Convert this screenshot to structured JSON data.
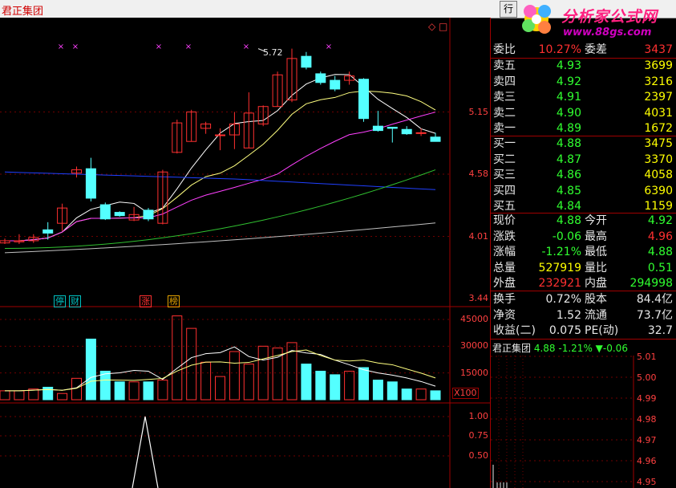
{
  "window": {
    "stock_name": "君正集团",
    "top_button": "行",
    "corner_icons": "◇ □"
  },
  "logo": {
    "main_text": "分析家公式网",
    "url": "www.88gs.com"
  },
  "kline": {
    "price_ticks": [
      "5.15",
      "4.58",
      "4.01",
      "3.44"
    ],
    "high_label": "5.72",
    "event_tags": [
      {
        "text": "停",
        "color": "#00c0c0"
      },
      {
        "text": "财",
        "color": "#00c0c0"
      },
      {
        "text": "涨",
        "color": "#ff3030"
      },
      {
        "text": "榜",
        "color": "#e0a000"
      }
    ],
    "colors": {
      "up": "#ff3030",
      "down": "#54ffff",
      "ma5": "#ffffff",
      "ma10": "#ffff80",
      "ma20": "#ff40ff",
      "ma60": "#2040ff",
      "ma120": "#30c030",
      "ma250": "#c0c0c0"
    }
  },
  "volume": {
    "ticks": [
      "45000",
      "30000",
      "15000"
    ],
    "unit": "X100"
  },
  "indicator": {
    "ticks": [
      "1.00",
      "0.75",
      "0.50"
    ]
  },
  "quote": {
    "weibi": {
      "label": "委比",
      "value": "10.27%",
      "label2": "委差",
      "value2": "3437"
    },
    "sell": [
      {
        "label": "卖五",
        "price": "4.93",
        "vol": "3699"
      },
      {
        "label": "卖四",
        "price": "4.92",
        "vol": "3216"
      },
      {
        "label": "卖三",
        "price": "4.91",
        "vol": "2397"
      },
      {
        "label": "卖二",
        "price": "4.90",
        "vol": "4031"
      },
      {
        "label": "卖一",
        "price": "4.89",
        "vol": "1672"
      }
    ],
    "buy": [
      {
        "label": "买一",
        "price": "4.88",
        "vol": "3475"
      },
      {
        "label": "买二",
        "price": "4.87",
        "vol": "3370"
      },
      {
        "label": "买三",
        "price": "4.86",
        "vol": "4058"
      },
      {
        "label": "买四",
        "price": "4.85",
        "vol": "6390"
      },
      {
        "label": "买五",
        "price": "4.84",
        "vol": "1159"
      }
    ],
    "stats": [
      {
        "l1": "现价",
        "v1": "4.88",
        "c1": "dn",
        "l2": "今开",
        "v2": "4.92",
        "c2": "dn"
      },
      {
        "l1": "涨跌",
        "v1": "-0.06",
        "c1": "dn",
        "l2": "最高",
        "v2": "4.96",
        "c2": "up"
      },
      {
        "l1": "涨幅",
        "v1": "-1.21%",
        "c1": "dn",
        "l2": "最低",
        "v2": "4.88",
        "c2": "dn"
      },
      {
        "l1": "总量",
        "v1": "527919",
        "c1": "ye",
        "l2": "量比",
        "v2": "0.51",
        "c2": "dn"
      },
      {
        "l1": "外盘",
        "v1": "232921",
        "c1": "up",
        "l2": "内盘",
        "v2": "294998",
        "c2": "dn"
      }
    ],
    "fin": [
      {
        "l1": "换手",
        "v1": "0.72%",
        "l2": "股本",
        "v2": "84.4亿"
      },
      {
        "l1": "净资",
        "v1": "1.52",
        "l2": "流通",
        "v2": "73.7亿"
      },
      {
        "l1": "收益(二)",
        "v1": "0.075",
        "l2": "PE(动)",
        "v2": "32.7"
      }
    ]
  },
  "mini": {
    "name": "君正集团",
    "price": "4.88",
    "pct": "-1.21%",
    "change": "▼-0.06",
    "ticks": [
      "5.01",
      "5.00",
      "4.99",
      "4.98",
      "4.97",
      "4.96",
      "4.95"
    ]
  },
  "chart_data": {
    "type": "candlestick",
    "title": "",
    "candles": [
      {
        "o": 3.95,
        "c": 3.97,
        "h": 3.99,
        "l": 3.94,
        "v": 5000
      },
      {
        "o": 3.96,
        "c": 3.97,
        "h": 4.03,
        "l": 3.94,
        "v": 5000
      },
      {
        "o": 3.97,
        "c": 4.0,
        "h": 4.03,
        "l": 3.95,
        "v": 6000
      },
      {
        "o": 4.07,
        "c": 4.04,
        "h": 4.14,
        "l": 3.98,
        "v": 7000
      },
      {
        "o": 4.13,
        "c": 4.27,
        "h": 4.31,
        "l": 4.06,
        "v": 3500
      },
      {
        "o": 4.59,
        "c": 4.62,
        "h": 4.65,
        "l": 4.55,
        "v": 12000
      },
      {
        "o": 4.63,
        "c": 4.36,
        "h": 4.73,
        "l": 4.33,
        "v": 34000
      },
      {
        "o": 4.3,
        "c": 4.17,
        "h": 4.32,
        "l": 4.16,
        "v": 16000
      },
      {
        "o": 4.23,
        "c": 4.2,
        "h": 4.24,
        "l": 4.19,
        "v": 10000
      },
      {
        "o": 4.16,
        "c": 4.21,
        "h": 4.28,
        "l": 4.15,
        "v": 10000
      },
      {
        "o": 4.25,
        "c": 4.17,
        "h": 4.27,
        "l": 4.15,
        "v": 10000
      },
      {
        "o": 4.13,
        "c": 4.6,
        "h": 4.62,
        "l": 4.12,
        "v": 11000
      },
      {
        "o": 4.78,
        "c": 5.05,
        "h": 5.08,
        "l": 4.77,
        "v": 47000
      },
      {
        "o": 4.88,
        "c": 5.15,
        "h": 5.17,
        "l": 4.88,
        "v": 40000
      },
      {
        "o": 5.0,
        "c": 5.04,
        "h": 5.06,
        "l": 4.95,
        "v": 21000
      },
      {
        "o": 4.94,
        "c": 4.94,
        "h": 5.0,
        "l": 4.8,
        "v": 13000
      },
      {
        "o": 4.94,
        "c": 5.04,
        "h": 5.15,
        "l": 4.81,
        "v": 27000
      },
      {
        "o": 4.82,
        "c": 5.14,
        "h": 5.33,
        "l": 4.82,
        "v": 20000
      },
      {
        "o": 5.04,
        "c": 5.2,
        "h": 5.21,
        "l": 5.02,
        "v": 30000
      },
      {
        "o": 5.2,
        "c": 5.49,
        "h": 5.52,
        "l": 5.2,
        "v": 29000
      },
      {
        "o": 5.26,
        "c": 5.64,
        "h": 5.73,
        "l": 5.24,
        "v": 32000
      },
      {
        "o": 5.66,
        "c": 5.56,
        "h": 5.7,
        "l": 5.54,
        "v": 20000
      },
      {
        "o": 5.5,
        "c": 5.42,
        "h": 5.52,
        "l": 5.4,
        "v": 16000
      },
      {
        "o": 5.44,
        "c": 5.36,
        "h": 5.48,
        "l": 5.34,
        "v": 14000
      },
      {
        "o": 5.44,
        "c": 5.48,
        "h": 5.52,
        "l": 5.4,
        "v": 16000
      },
      {
        "o": 5.45,
        "c": 5.09,
        "h": 5.46,
        "l": 5.06,
        "v": 18000
      },
      {
        "o": 5.02,
        "c": 4.98,
        "h": 5.16,
        "l": 4.97,
        "v": 11000
      },
      {
        "o": 5.01,
        "c": 5.0,
        "h": 5.01,
        "l": 4.87,
        "v": 10000
      },
      {
        "o": 4.99,
        "c": 4.95,
        "h": 5.02,
        "l": 4.94,
        "v": 6000
      },
      {
        "o": 4.96,
        "c": 4.96,
        "h": 5.0,
        "l": 4.93,
        "v": 6000
      },
      {
        "o": 4.92,
        "c": 4.88,
        "h": 4.96,
        "l": 4.88,
        "v": 5000
      }
    ],
    "ylim": [
      3.44,
      5.72
    ],
    "volume_ylim": [
      0,
      45000
    ]
  }
}
